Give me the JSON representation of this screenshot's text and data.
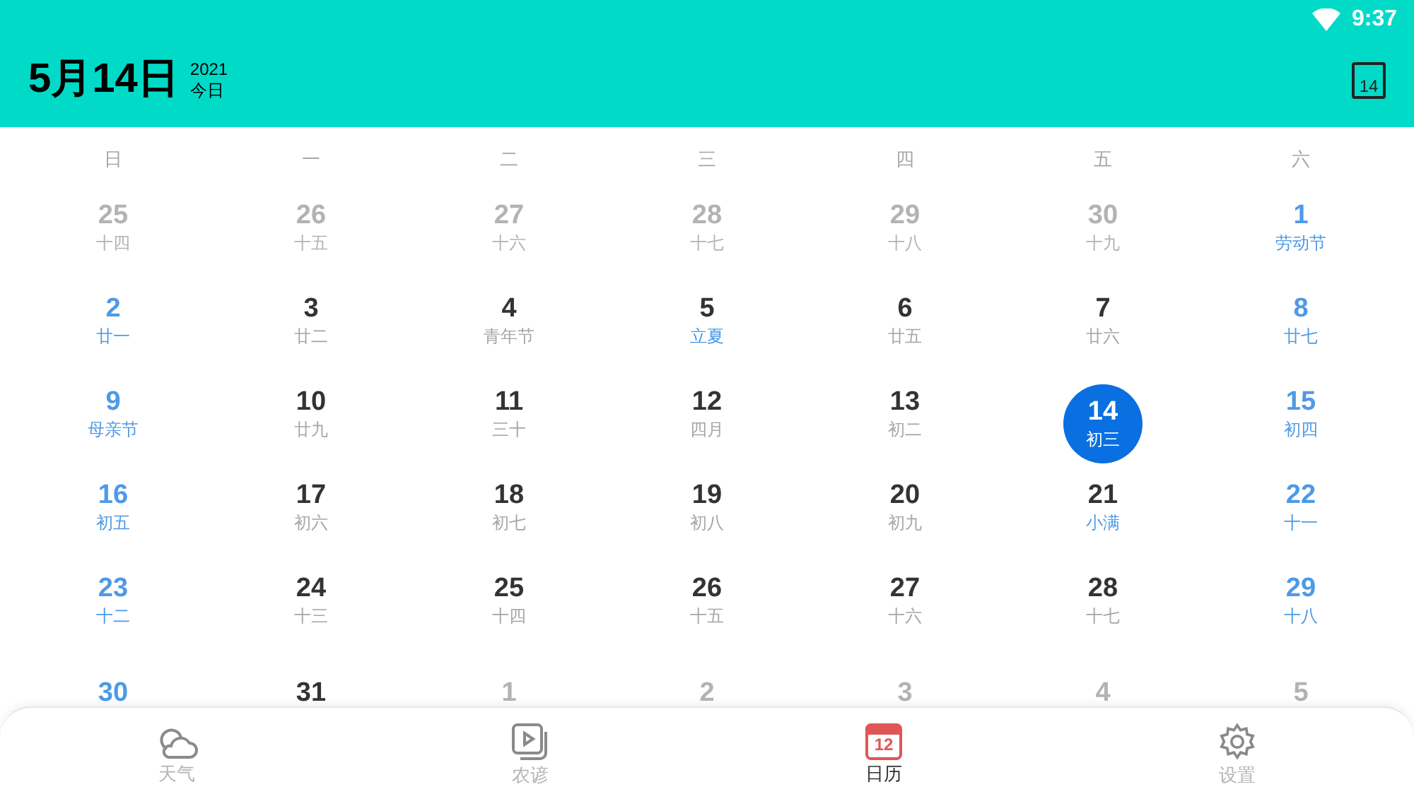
{
  "status_bar": {
    "time": "9:37"
  },
  "header": {
    "date": "5月14日",
    "year": "2021",
    "today_label": "今日",
    "calendar_button_text": "14"
  },
  "weekdays": [
    "日",
    "一",
    "二",
    "三",
    "四",
    "五",
    "六"
  ],
  "weeks": [
    [
      {
        "day": "25",
        "lunar": "十四",
        "kind": "other",
        "selected": false
      },
      {
        "day": "26",
        "lunar": "十五",
        "kind": "other",
        "selected": false
      },
      {
        "day": "27",
        "lunar": "十六",
        "kind": "other",
        "selected": false
      },
      {
        "day": "28",
        "lunar": "十七",
        "kind": "other",
        "selected": false
      },
      {
        "day": "29",
        "lunar": "十八",
        "kind": "other",
        "selected": false
      },
      {
        "day": "30",
        "lunar": "十九",
        "kind": "other",
        "selected": false
      },
      {
        "day": "1",
        "lunar": "劳动节",
        "kind": "weekend",
        "lunar_highlight": true,
        "selected": false
      }
    ],
    [
      {
        "day": "2",
        "lunar": "廿一",
        "kind": "weekend",
        "lunar_highlight": true,
        "selected": false
      },
      {
        "day": "3",
        "lunar": "廿二",
        "kind": "weekday",
        "lunar_highlight": false,
        "selected": false
      },
      {
        "day": "4",
        "lunar": "青年节",
        "kind": "weekday",
        "lunar_highlight": false,
        "selected": false
      },
      {
        "day": "5",
        "lunar": "立夏",
        "kind": "weekday",
        "lunar_highlight": true,
        "selected": false
      },
      {
        "day": "6",
        "lunar": "廿五",
        "kind": "weekday",
        "lunar_highlight": false,
        "selected": false
      },
      {
        "day": "7",
        "lunar": "廿六",
        "kind": "weekday",
        "lunar_highlight": false,
        "selected": false
      },
      {
        "day": "8",
        "lunar": "廿七",
        "kind": "weekend",
        "lunar_highlight": true,
        "selected": false
      }
    ],
    [
      {
        "day": "9",
        "lunar": "母亲节",
        "kind": "weekend",
        "lunar_highlight": true,
        "selected": false
      },
      {
        "day": "10",
        "lunar": "廿九",
        "kind": "weekday",
        "lunar_highlight": false,
        "selected": false
      },
      {
        "day": "11",
        "lunar": "三十",
        "kind": "weekday",
        "lunar_highlight": false,
        "selected": false
      },
      {
        "day": "12",
        "lunar": "四月",
        "kind": "weekday",
        "lunar_highlight": false,
        "selected": false
      },
      {
        "day": "13",
        "lunar": "初二",
        "kind": "weekday",
        "lunar_highlight": false,
        "selected": false
      },
      {
        "day": "14",
        "lunar": "初三",
        "selected": true
      },
      {
        "day": "15",
        "lunar": "初四",
        "kind": "weekend",
        "lunar_highlight": true,
        "selected": false
      }
    ],
    [
      {
        "day": "16",
        "lunar": "初五",
        "kind": "weekend",
        "lunar_highlight": true,
        "selected": false
      },
      {
        "day": "17",
        "lunar": "初六",
        "kind": "weekday",
        "lunar_highlight": false,
        "selected": false
      },
      {
        "day": "18",
        "lunar": "初七",
        "kind": "weekday",
        "lunar_highlight": false,
        "selected": false
      },
      {
        "day": "19",
        "lunar": "初八",
        "kind": "weekday",
        "lunar_highlight": false,
        "selected": false
      },
      {
        "day": "20",
        "lunar": "初九",
        "kind": "weekday",
        "lunar_highlight": false,
        "selected": false
      },
      {
        "day": "21",
        "lunar": "小满",
        "kind": "weekday",
        "lunar_highlight": true,
        "selected": false
      },
      {
        "day": "22",
        "lunar": "十一",
        "kind": "weekend",
        "lunar_highlight": true,
        "selected": false
      }
    ],
    [
      {
        "day": "23",
        "lunar": "十二",
        "kind": "weekend",
        "lunar_highlight": true,
        "selected": false
      },
      {
        "day": "24",
        "lunar": "十三",
        "kind": "weekday",
        "lunar_highlight": false,
        "selected": false
      },
      {
        "day": "25",
        "lunar": "十四",
        "kind": "weekday",
        "lunar_highlight": false,
        "selected": false
      },
      {
        "day": "26",
        "lunar": "十五",
        "kind": "weekday",
        "lunar_highlight": false,
        "selected": false
      },
      {
        "day": "27",
        "lunar": "十六",
        "kind": "weekday",
        "lunar_highlight": false,
        "selected": false
      },
      {
        "day": "28",
        "lunar": "十七",
        "kind": "weekday",
        "lunar_highlight": false,
        "selected": false
      },
      {
        "day": "29",
        "lunar": "十八",
        "kind": "weekend",
        "lunar_highlight": true,
        "selected": false
      }
    ],
    [
      {
        "day": "30",
        "kind": "weekend",
        "selected": false
      },
      {
        "day": "31",
        "kind": "weekday",
        "selected": false
      },
      {
        "day": "1",
        "kind": "other",
        "selected": false
      },
      {
        "day": "2",
        "kind": "other",
        "selected": false
      },
      {
        "day": "3",
        "kind": "other",
        "selected": false
      },
      {
        "day": "4",
        "kind": "other",
        "selected": false
      },
      {
        "day": "5",
        "kind": "other",
        "selected": false
      }
    ]
  ],
  "bottom_nav": [
    {
      "kind": "weather",
      "label": "天气",
      "selected": false
    },
    {
      "kind": "video",
      "label": "农谚",
      "selected": false
    },
    {
      "kind": "calendar",
      "label": "日历",
      "icon_text": "12",
      "selected": true
    },
    {
      "kind": "settings",
      "label": "设置",
      "selected": false
    }
  ]
}
